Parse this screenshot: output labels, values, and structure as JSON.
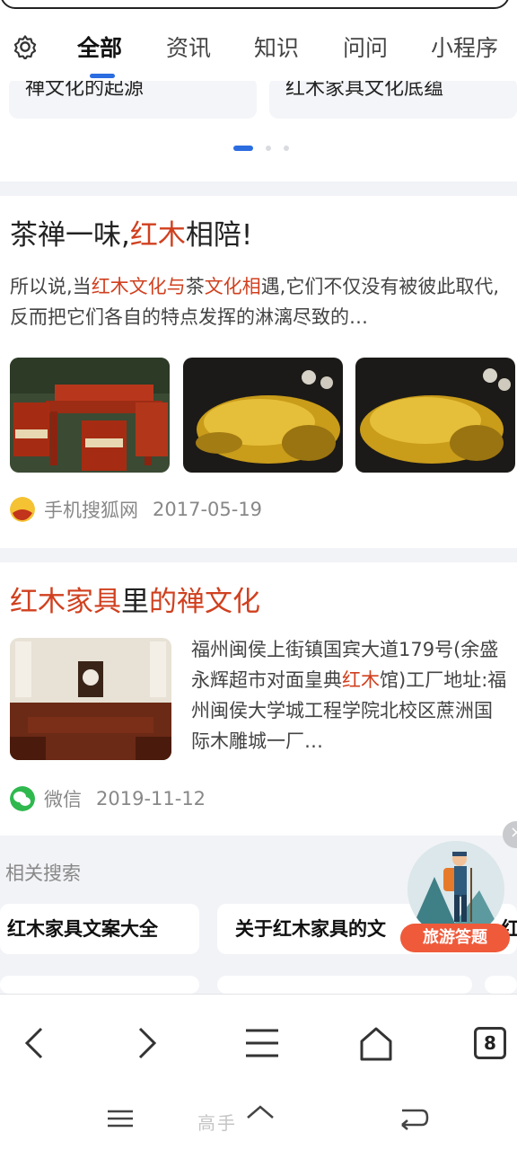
{
  "tabs": {
    "items": [
      {
        "label": "全部",
        "active": true
      },
      {
        "label": "资讯",
        "active": false
      },
      {
        "label": "知识",
        "active": false
      },
      {
        "label": "问问",
        "active": false
      },
      {
        "label": "小程序",
        "active": false
      }
    ],
    "gear_icon": "gear-icon"
  },
  "carousel": {
    "cards": [
      "禅文化的起源",
      "红木家具文化底蕴"
    ],
    "dot_count": 3,
    "active_dot": 1
  },
  "results": [
    {
      "title_parts": [
        "茶禅一味,",
        "红木",
        "相陪!"
      ],
      "summary_parts": [
        "所以说,当",
        "红木文化与",
        "茶",
        "文化相",
        "遇,它们不仅没有被彼此取代,反而把它们各自的特点发挥的淋漓尽致的…"
      ],
      "images": [
        "red-wood-tea-set-photo",
        "root-carving-tray-photo",
        "root-carving-tray-photo-2"
      ],
      "source": "手机搜狐网",
      "date": "2017-05-19"
    },
    {
      "title_parts": [
        "红木家具",
        "里",
        "的禅文化"
      ],
      "summary_parts": [
        "福州闽侯上街镇国宾大道179号(余盛永辉超市对面皇典",
        "红木",
        "馆)工厂地址:福州闽侯大学城工程学院北校区蔗洲国际木雕城一厂…"
      ],
      "image": "redwood-room-photo",
      "source": "微信",
      "date": "2019-11-12"
    }
  ],
  "related": {
    "heading": "相关搜索",
    "chips": [
      "红木家具文案大全",
      "关于红木家具的文",
      "红木"
    ]
  },
  "float_ad": {
    "label": "旅游答题",
    "close": "×"
  },
  "bottom_nav": {
    "tab_count": "8",
    "icons": [
      "back-icon",
      "forward-icon",
      "menu-icon",
      "home-icon",
      "tabs-icon"
    ]
  },
  "watermark": "高手",
  "colors": {
    "accent": "#2b6ce0",
    "highlight": "#d0401f",
    "ad": "#ef5a3a"
  }
}
